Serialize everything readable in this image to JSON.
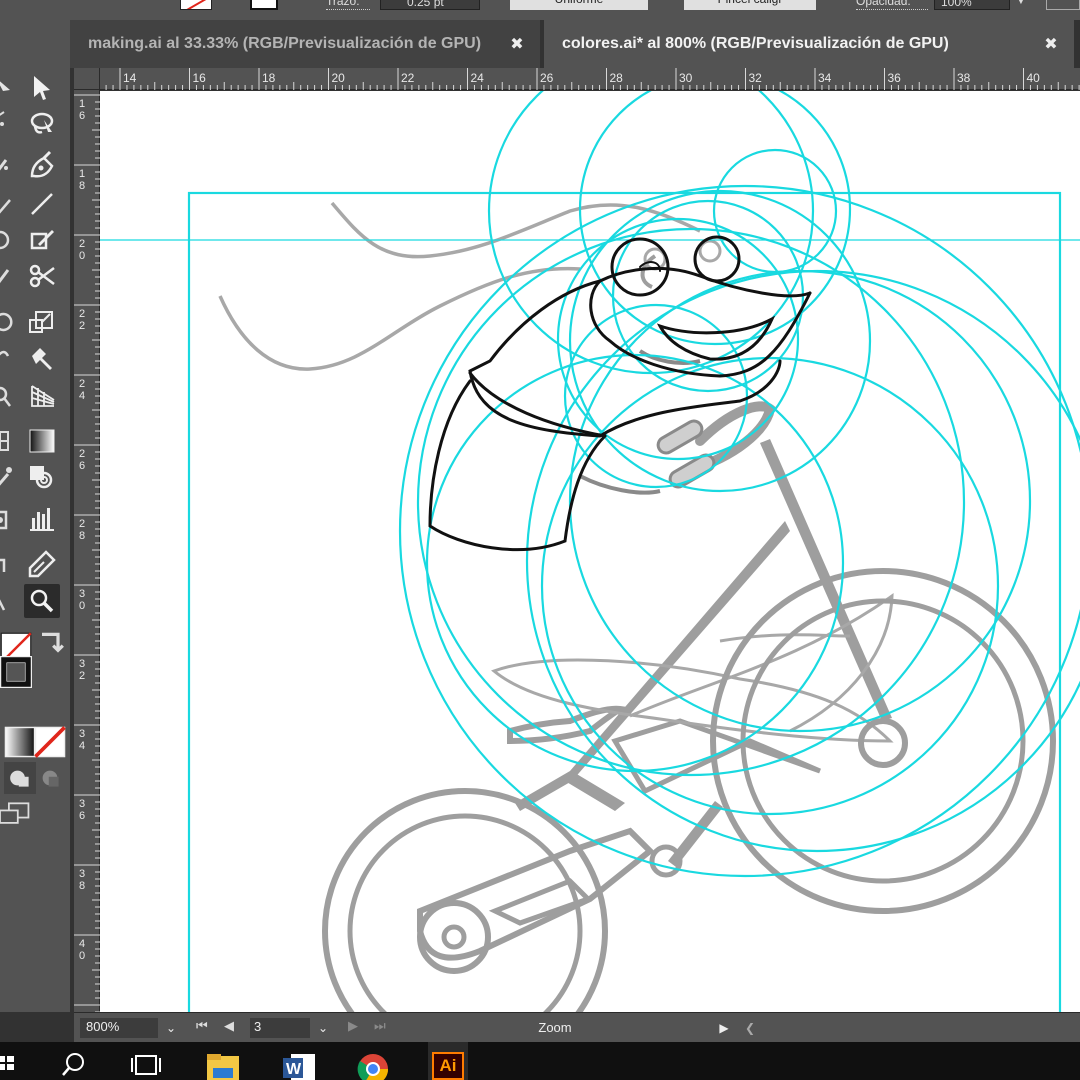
{
  "control_bar": {
    "stroke_label": "Trazo:",
    "stroke_value": "0.25 pt",
    "variable_width_profile": "Uniforme",
    "brush_definition": "Pincel caligr",
    "opacity_label": "Opacidad:",
    "opacity_value": "100%"
  },
  "tabs": [
    {
      "title": "making.ai al 33.33% (RGB/Previsualización de GPU)",
      "close": "✖",
      "active": false
    },
    {
      "title": "colores.ai* al 800% (RGB/Previsualización de GPU)",
      "close": "✖",
      "active": true
    }
  ],
  "ruler_h": {
    "labels": [
      "14",
      "16",
      "18",
      "20",
      "22",
      "24",
      "26",
      "28",
      "30",
      "32",
      "34",
      "36",
      "38",
      "40"
    ]
  },
  "ruler_v": {
    "labels": [
      "16",
      "18",
      "20",
      "22",
      "24",
      "26",
      "28",
      "30",
      "32",
      "34",
      "36",
      "38",
      "40"
    ]
  },
  "status_bar": {
    "zoom": "800%",
    "artboard_number": "3",
    "label": "Zoom",
    "dropdown": "⌄"
  },
  "toolbar": {
    "tools": [
      "selection",
      "direct-selection",
      "pen",
      "curvature",
      "line",
      "paintbrush",
      "ellipse",
      "shaper",
      "eraser",
      "scissors",
      "rotate",
      "scale",
      "width",
      "puppet-warp",
      "shape-builder",
      "perspective-grid",
      "mesh",
      "gradient",
      "eyedropper",
      "blend",
      "symbol-sprayer",
      "column-graph",
      "artboard",
      "slice",
      "hand",
      "zoom"
    ]
  },
  "colors": {
    "accent_guide": "#19d9e0",
    "sketch_gray": "#9e9e9e",
    "ink_black": "#111111",
    "ui_panel": "#535353",
    "ui_dark": "#323232"
  },
  "taskbar": {
    "apps": [
      "start",
      "search",
      "task-view",
      "file-explorer",
      "word",
      "chrome",
      "illustrator"
    ],
    "illustrator_label": "Ai"
  }
}
